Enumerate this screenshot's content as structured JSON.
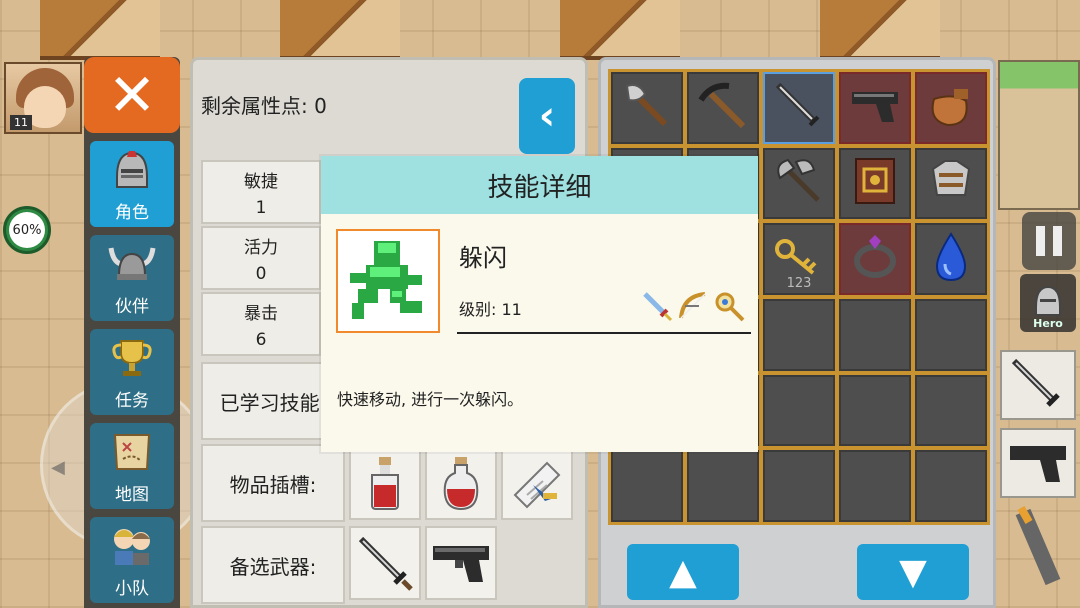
{
  "hud": {
    "portrait_level": "11",
    "hp_percent": "60%",
    "hero_label": "Hero"
  },
  "tabs": [
    {
      "label": "角色",
      "icon": "knight-helmet-icon",
      "active": true
    },
    {
      "label": "伙伴",
      "icon": "horned-helmet-icon",
      "active": false
    },
    {
      "label": "任务",
      "icon": "trophy-icon",
      "active": false
    },
    {
      "label": "地图",
      "icon": "map-scroll-icon",
      "active": false
    },
    {
      "label": "小队",
      "icon": "party-icon",
      "active": false
    }
  ],
  "stats": {
    "remaining_points_label": "剩余属性点: 0",
    "agility": {
      "label": "敏捷",
      "value": "1"
    },
    "vitality": {
      "label": "活力",
      "value": "0"
    },
    "crit": {
      "label": "暴击",
      "value": "6"
    },
    "learned_skills_label": "已学习技能:",
    "item_slots_label": "物品插槽:",
    "backup_weapons_label": "备选武器:"
  },
  "inventory": {
    "items": [
      {
        "icon": "axe-icon"
      },
      {
        "icon": "pickaxe-icon"
      },
      {
        "icon": "sword-icon",
        "selected": true
      },
      {
        "icon": "pistol-icon",
        "red": true
      },
      {
        "icon": "bag-icon",
        "red": true
      },
      {
        "icon": "empty"
      },
      {
        "icon": "empty"
      },
      {
        "icon": "battle-axe-icon"
      },
      {
        "icon": "spellbook-icon"
      },
      {
        "icon": "armor-icon"
      },
      {
        "icon": "empty"
      },
      {
        "icon": "empty"
      },
      {
        "icon": "key-icon",
        "count": "123"
      },
      {
        "icon": "ring-icon",
        "red": true
      },
      {
        "icon": "blue-gem-icon"
      }
    ]
  },
  "modal": {
    "title": "技能详细",
    "skill_name": "躲闪",
    "skill_level": "级别: 11",
    "skill_description": "快速移动, 进行一次躲闪。",
    "class_icons": [
      "sword-class-icon",
      "bow-class-icon",
      "staff-class-icon"
    ]
  },
  "colors": {
    "accent_blue": "#1f9fd4",
    "close_orange": "#e46a22",
    "modal_header": "#9fe0e0",
    "inventory_frame": "#c9932f"
  }
}
